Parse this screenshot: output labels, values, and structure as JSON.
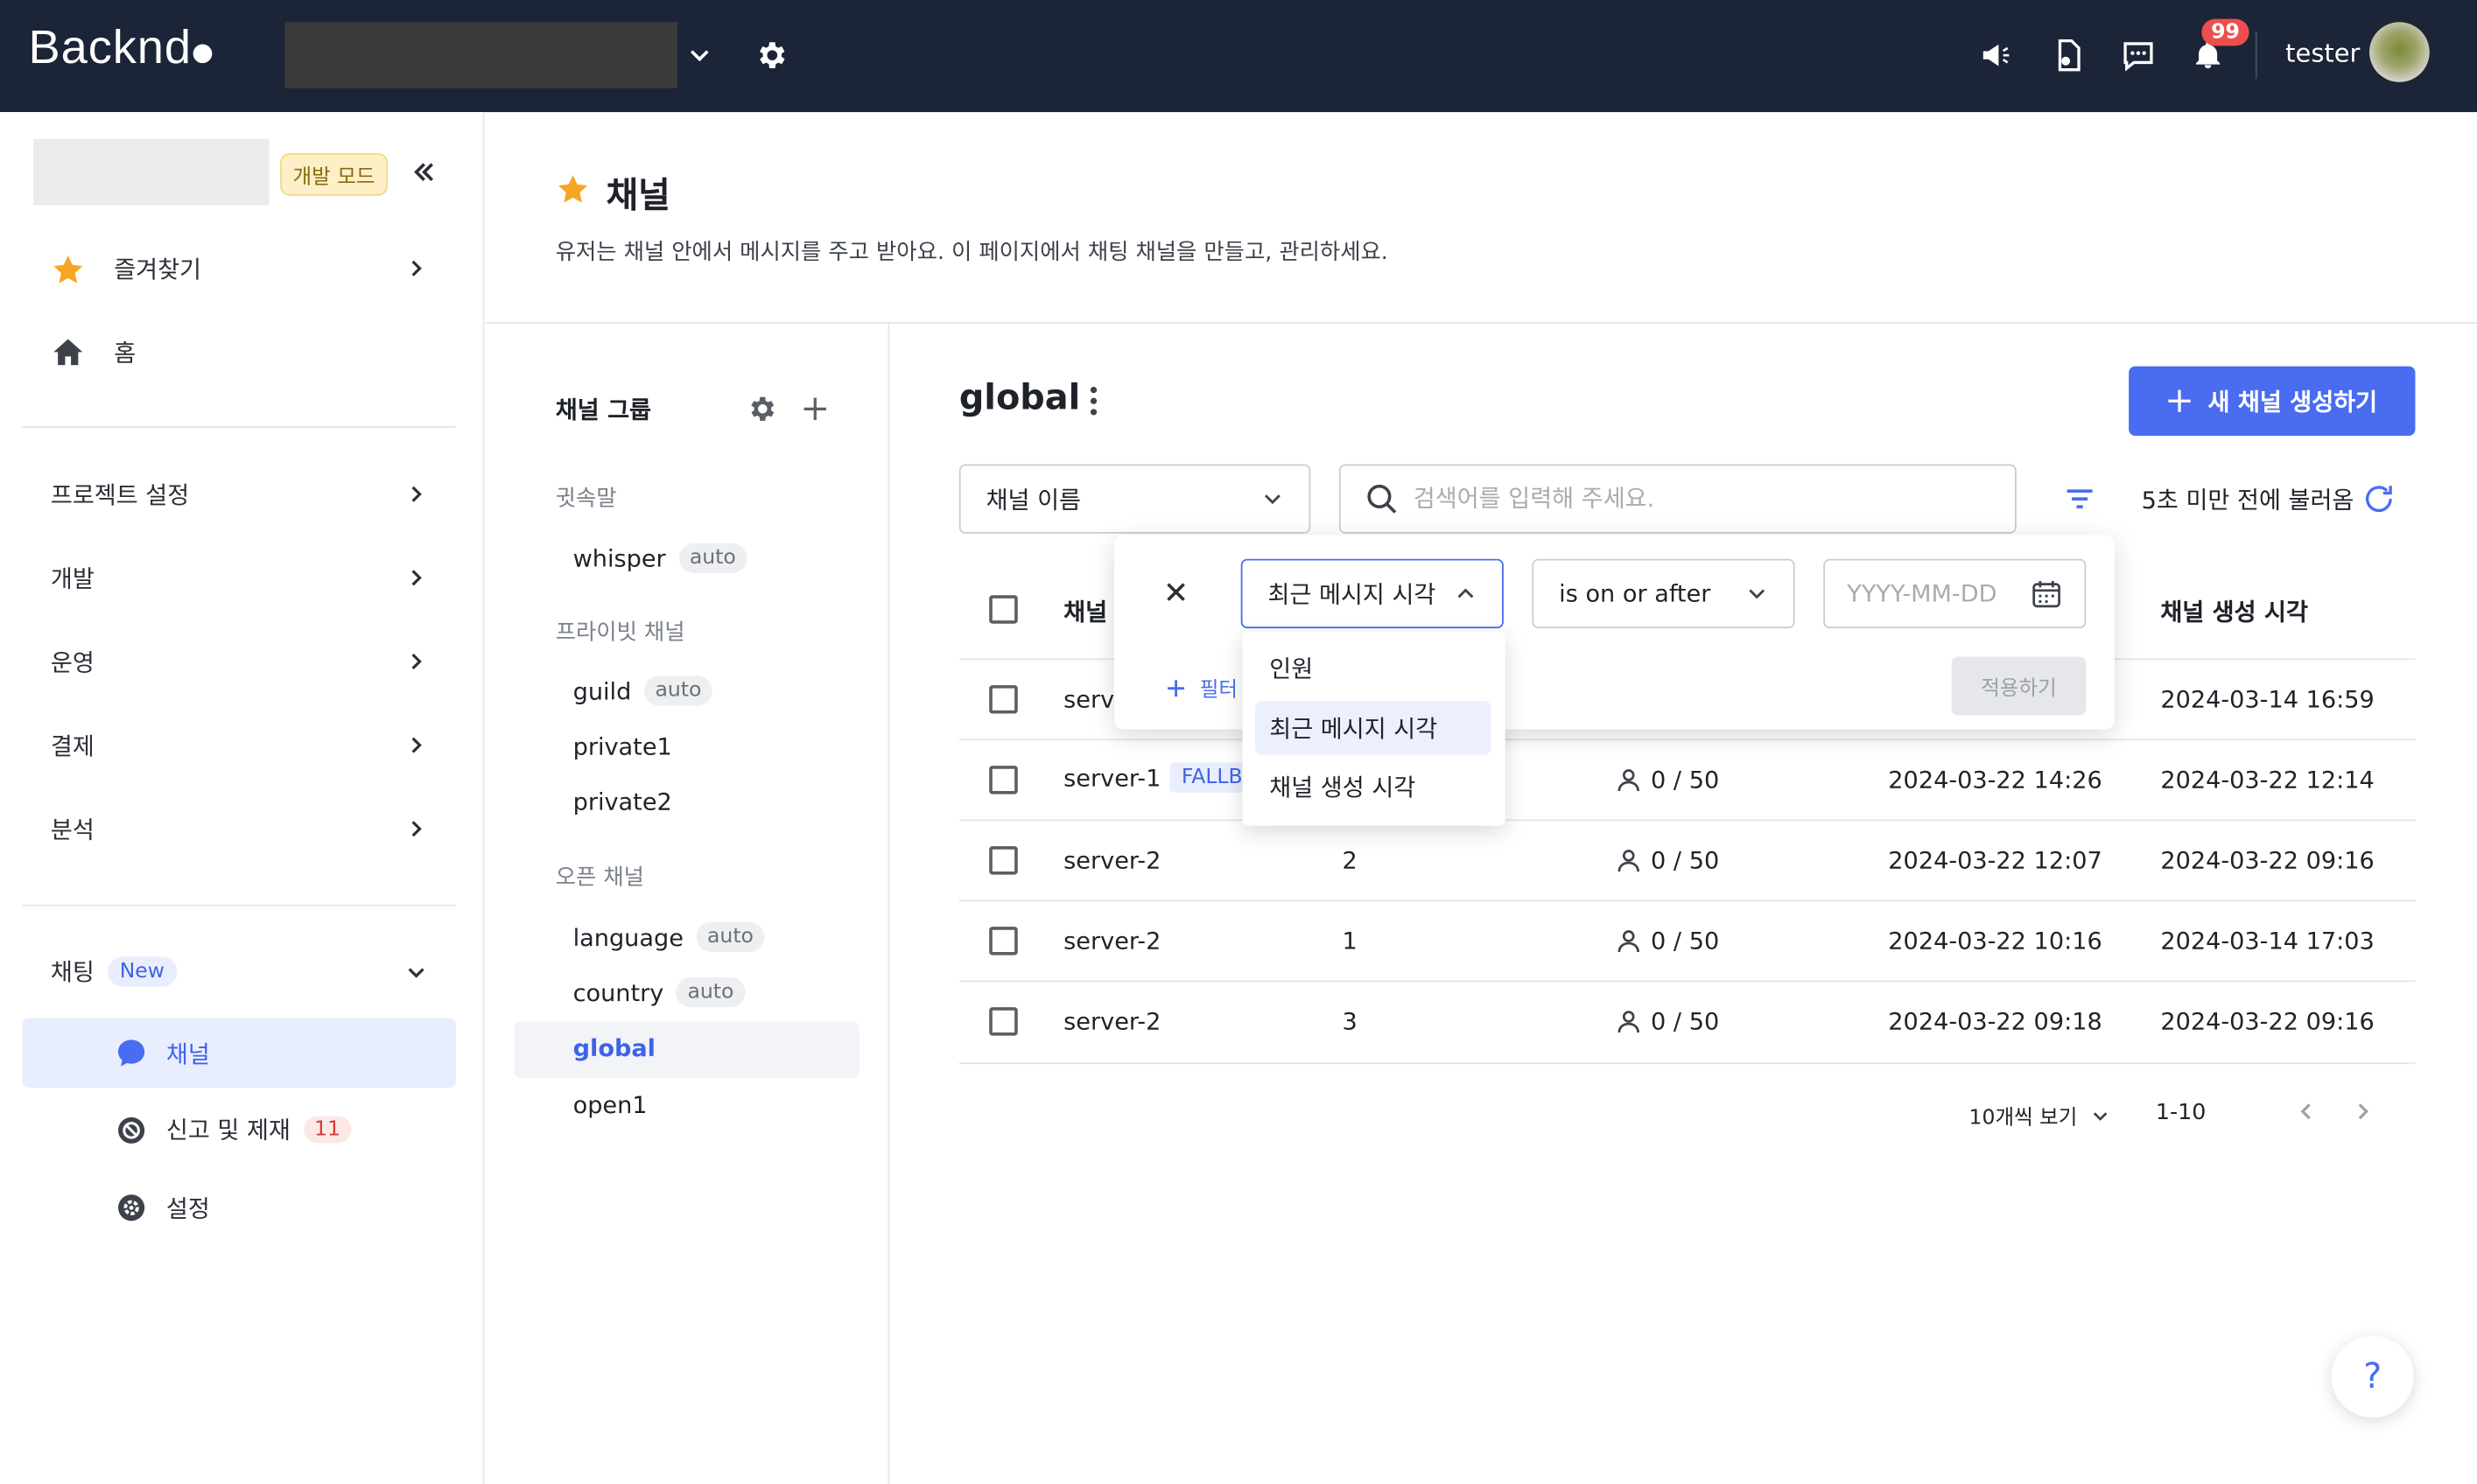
{
  "topbar": {
    "logo": "Backnd",
    "username": "tester",
    "notification_count": "99"
  },
  "sidebar": {
    "mode_badge": "개발 모드",
    "items": [
      {
        "label": "즐겨찾기"
      },
      {
        "label": "홈"
      },
      {
        "label": "프로젝트 설정"
      },
      {
        "label": "개발"
      },
      {
        "label": "운영"
      },
      {
        "label": "결제"
      },
      {
        "label": "분석"
      }
    ],
    "chat": {
      "label": "채팅",
      "badge": "New",
      "children": [
        {
          "label": "채널"
        },
        {
          "label": "신고 및 제재",
          "count": "11"
        },
        {
          "label": "설정"
        }
      ]
    }
  },
  "page": {
    "title": "채널",
    "description": "유저는 채널 안에서 메시지를 주고 받아요. 이 페이지에서 채팅 채널을 만들고, 관리하세요."
  },
  "groups": {
    "title": "채널 그룹",
    "sections": [
      {
        "label": "귓속말"
      },
      {
        "label": "프라이빗 채널"
      },
      {
        "label": "오픈 채널"
      }
    ],
    "items": [
      {
        "label": "whisper",
        "badge": "auto"
      },
      {
        "label": "guild",
        "badge": "auto"
      },
      {
        "label": "private1"
      },
      {
        "label": "private2"
      },
      {
        "label": "language",
        "badge": "auto"
      },
      {
        "label": "country",
        "badge": "auto"
      },
      {
        "label": "global"
      },
      {
        "label": "open1"
      }
    ]
  },
  "content": {
    "title": "global",
    "new_button": "새 채널 생성하기",
    "field_select": "채널 이름",
    "search_placeholder": "검색어를 입력해 주세요.",
    "refresh_text": "5초 미만 전에 불러옴",
    "columns": {
      "name": "채널",
      "created": "채널 생성 시각"
    },
    "rows": [
      {
        "name": "serv",
        "tag": "",
        "users": "",
        "members": "",
        "last_msg": "",
        "created": "2024-03-14 16:59"
      },
      {
        "name": "server-1",
        "tag": "FALLBA",
        "users": "",
        "members": "0 / 50",
        "last_msg": "2024-03-22 14:26",
        "created": "2024-03-22 12:14"
      },
      {
        "name": "server-2",
        "tag": "",
        "users": "2",
        "members": "0 / 50",
        "last_msg": "2024-03-22 12:07",
        "created": "2024-03-22 09:16"
      },
      {
        "name": "server-2",
        "tag": "",
        "users": "1",
        "members": "0 / 50",
        "last_msg": "2024-03-22 10:16",
        "created": "2024-03-14 17:03"
      },
      {
        "name": "server-2",
        "tag": "",
        "users": "3",
        "members": "0 / 50",
        "last_msg": "2024-03-22 09:18",
        "created": "2024-03-22 09:16"
      }
    ],
    "pagination": {
      "per_page": "10개씩 보기",
      "range": "1-10"
    }
  },
  "filter": {
    "field": "최근 메시지 시각",
    "operator": "is on or after",
    "date_placeholder": "YYYY-MM-DD",
    "add_filter": "필터",
    "apply": "적용하기",
    "options": [
      {
        "label": "인원"
      },
      {
        "label": "최근 메시지 시각"
      },
      {
        "label": "채널 생성 시각"
      }
    ]
  },
  "help": "?",
  "colors": {
    "topbar": "#1c2437",
    "accent": "#4a6cf0",
    "star": "#f5a623"
  }
}
